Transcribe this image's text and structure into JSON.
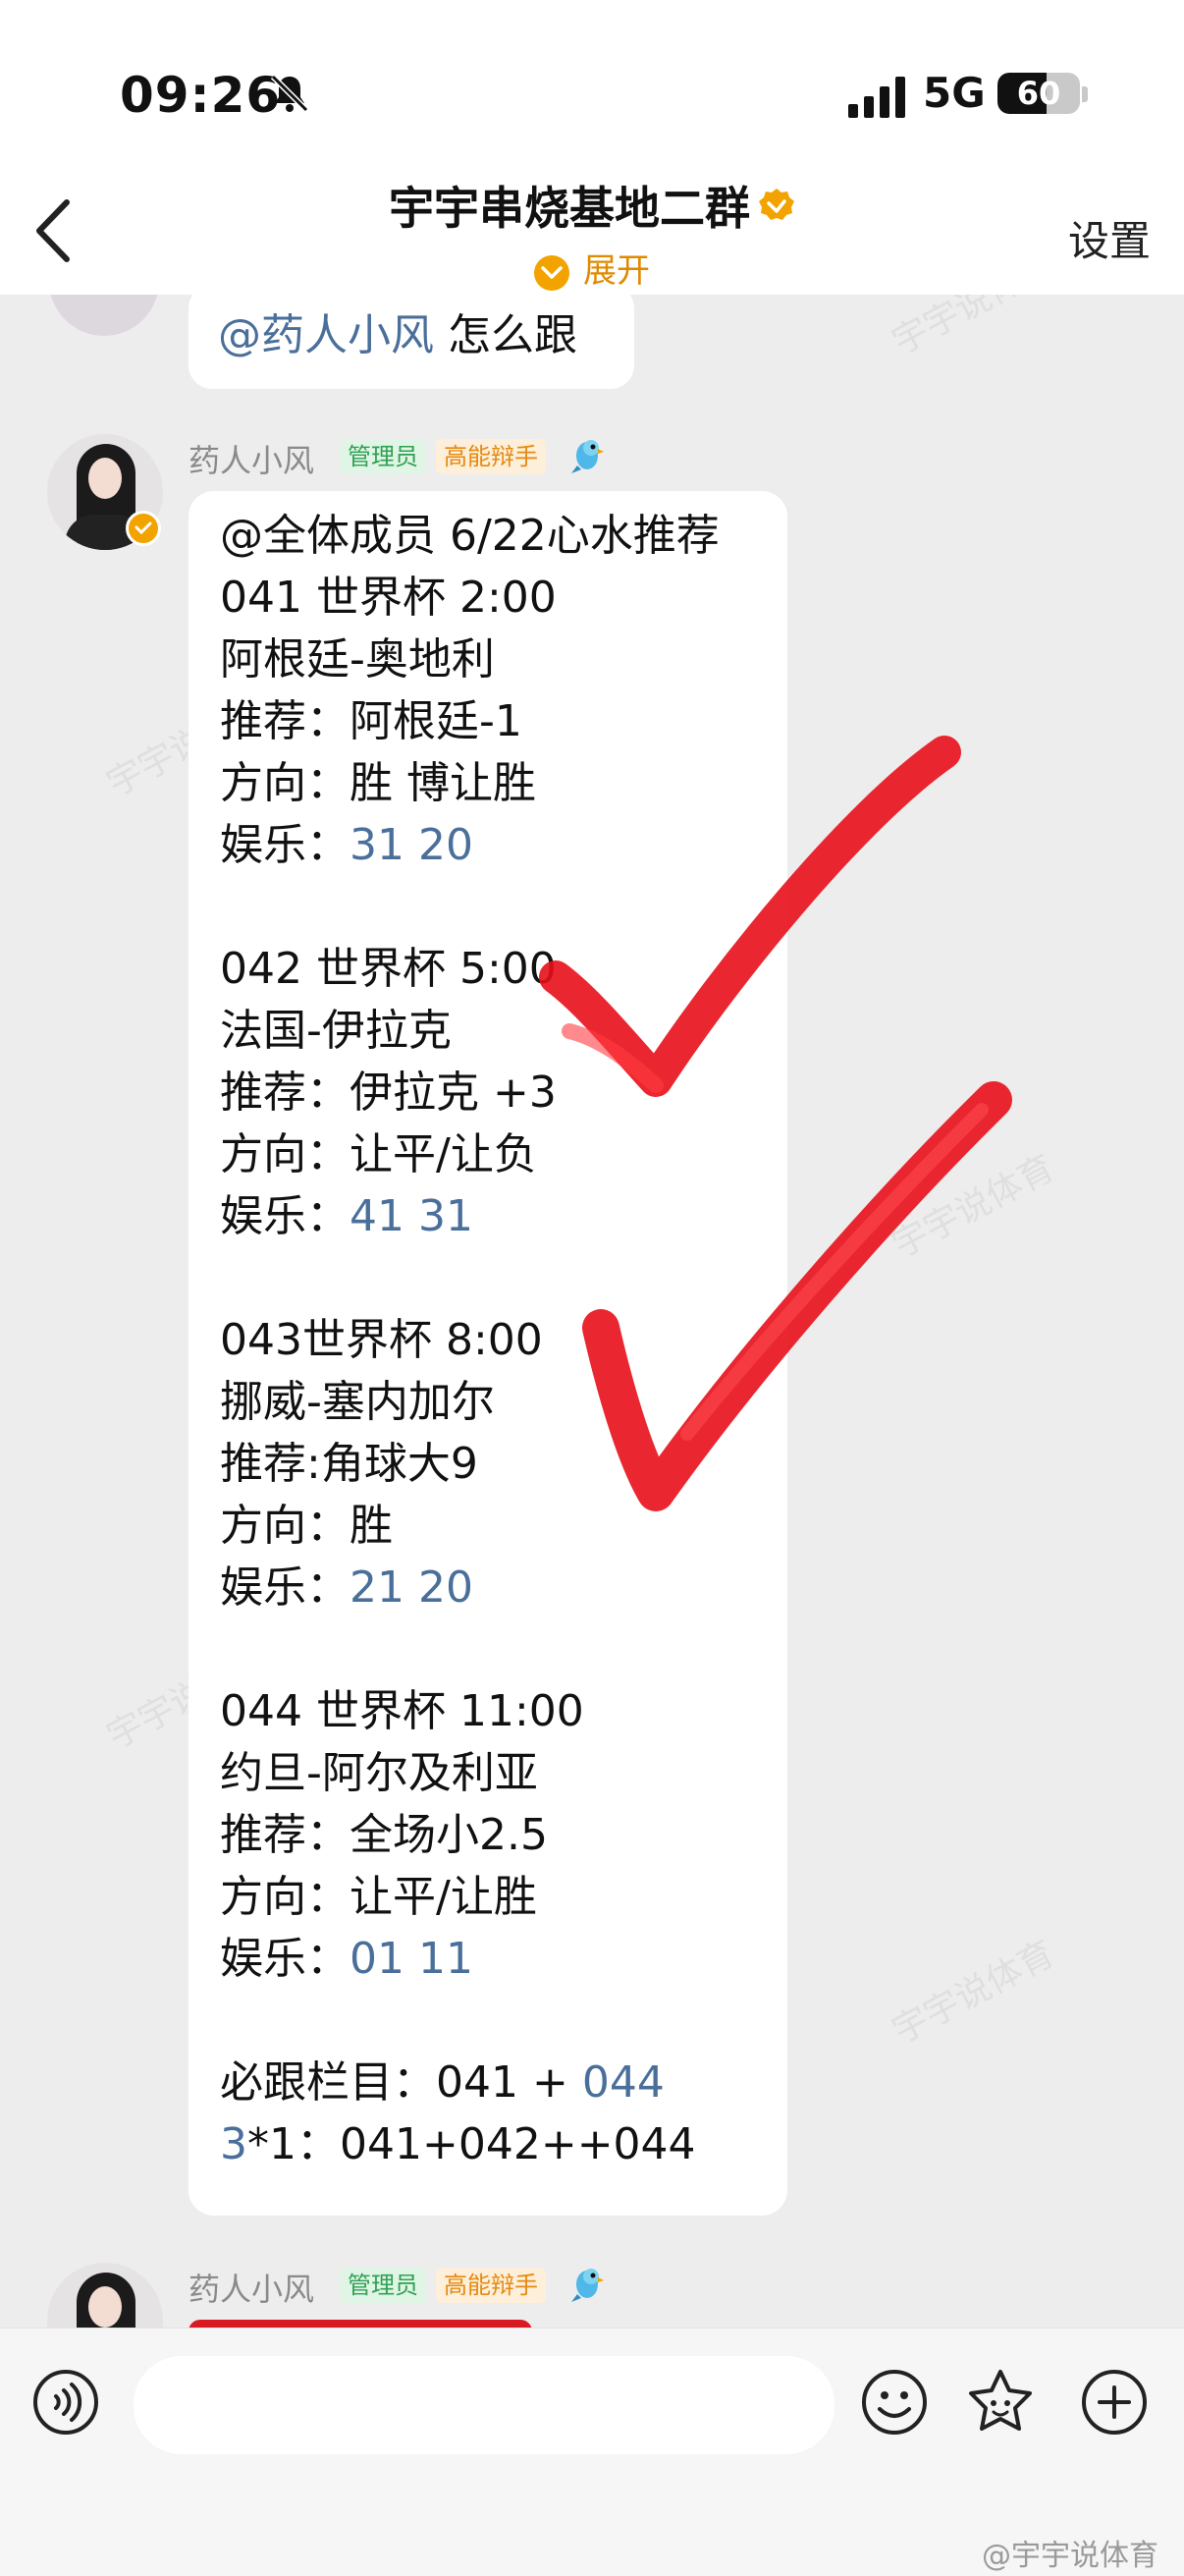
{
  "status_bar": {
    "time": "09:26",
    "network": "5G",
    "battery_level": 60,
    "battery_text": "60"
  },
  "header": {
    "title": "宇宇串烧基地二群",
    "expand_label": "展开",
    "settings_label": "设置"
  },
  "previous_message": {
    "mention": "@药人小风",
    "text": " 怎么跟"
  },
  "message": {
    "sender": "药人小风",
    "tags": [
      "管理员",
      "高能辩手"
    ],
    "lines": [
      {
        "t": "@全体成员 6/22心水推荐"
      },
      {
        "t": "041 世界杯 2:00"
      },
      {
        "t": "阿根廷-奥地利"
      },
      {
        "t": "推荐：阿根廷-1"
      },
      {
        "t": "方向：胜 博让胜"
      },
      {
        "t": "娱乐：",
        "link": "31 20"
      },
      {
        "t": ""
      },
      {
        "t": "042 世界杯 5:00"
      },
      {
        "t": "法国-伊拉克"
      },
      {
        "t": "推荐：伊拉克 +3"
      },
      {
        "t": "方向：让平/让负"
      },
      {
        "t": "娱乐：",
        "link": "41 31"
      },
      {
        "t": ""
      },
      {
        "t": "043世界杯 8:00"
      },
      {
        "t": "挪威-塞内加尔"
      },
      {
        "t": "推荐:角球大9"
      },
      {
        "t": "方向：胜"
      },
      {
        "t": "娱乐：",
        "link": "21 20"
      },
      {
        "t": ""
      },
      {
        "t": "044 世界杯 11:00"
      },
      {
        "t": "约旦-阿尔及利亚"
      },
      {
        "t": "推荐：全场小2.5"
      },
      {
        "t": "方向：让平/让胜"
      },
      {
        "t": "娱乐：",
        "link": "01 11"
      },
      {
        "t": ""
      },
      {
        "t": "必跟栏目：041 + ",
        "link": "044"
      },
      {
        "link_first": "3",
        "t": "*1：041+042++044"
      }
    ]
  },
  "next_message": {
    "sender": "药人小风",
    "tags": [
      "管理员",
      "高能辩手"
    ]
  },
  "watermark": "宇宇说体育",
  "credit": "@宇宇说体育",
  "colors": {
    "accent": "#f2a300",
    "link": "#4a6f9a",
    "check_mark": "#e8101a",
    "admin_tag": "#2fa152",
    "level_tag": "#e58a10"
  }
}
